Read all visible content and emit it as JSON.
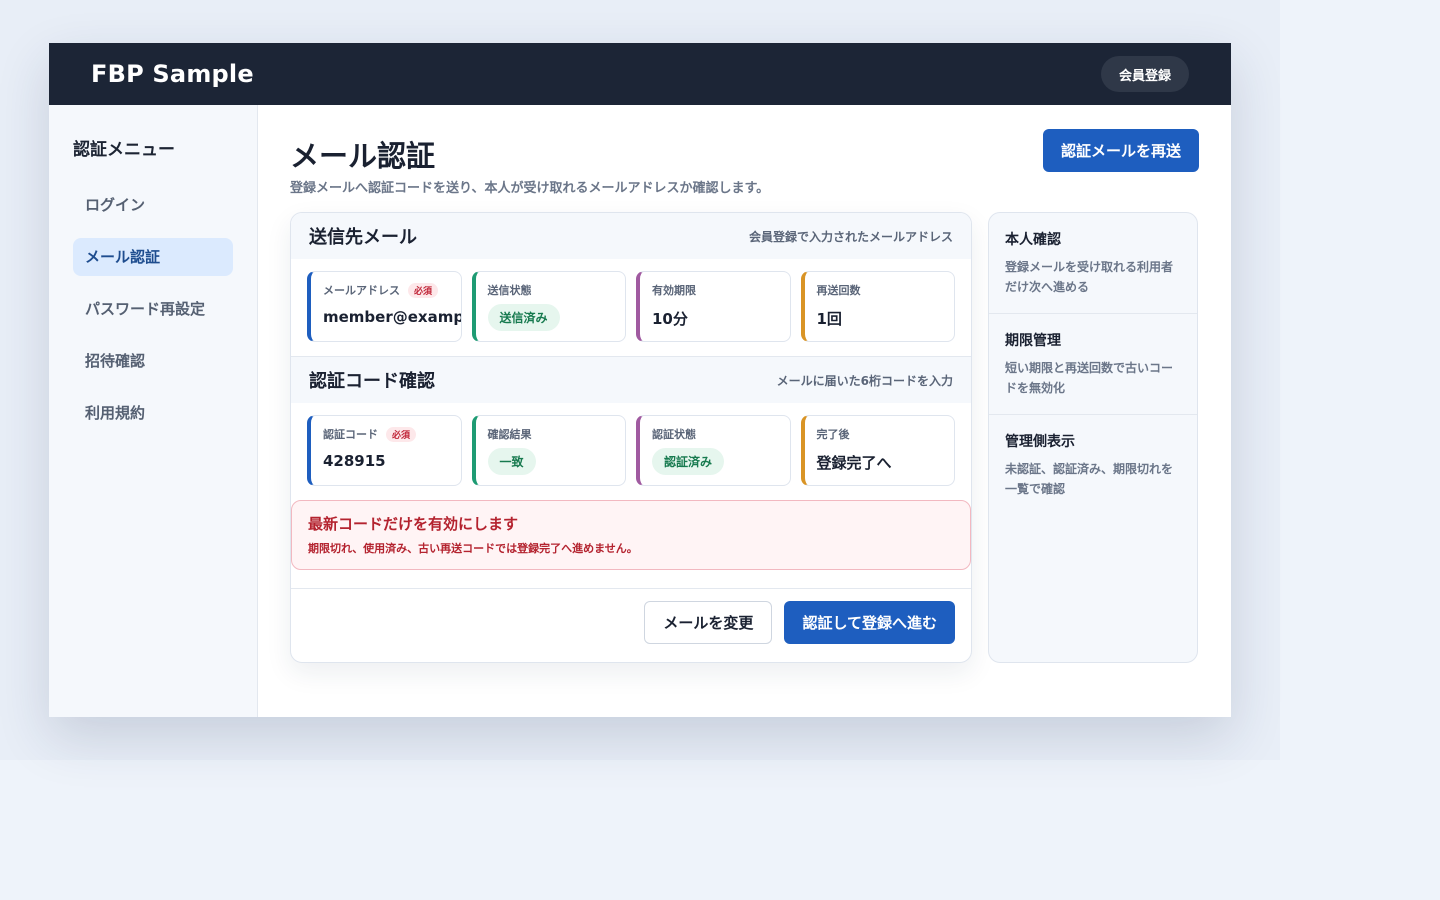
{
  "header": {
    "brand": "FBP Sample",
    "register_button": "会員登録"
  },
  "sidebar": {
    "title": "認証メニュー",
    "items": [
      {
        "label": "ログイン",
        "active": false
      },
      {
        "label": "メール認証",
        "active": true
      },
      {
        "label": "パスワード再設定",
        "active": false
      },
      {
        "label": "招待確認",
        "active": false
      },
      {
        "label": "利用規約",
        "active": false
      }
    ]
  },
  "main": {
    "title": "メール認証",
    "subtitle": "登録メールへ認証コードを送り、本人が受け取れるメールアドレスか確認します。",
    "resend_button": "認証メールを再送"
  },
  "sections": [
    {
      "title": "送信先メール",
      "note": "会員登録で入力されたメールアドレス",
      "fields": [
        {
          "label": "メールアドレス",
          "required": "必須",
          "value": "member@example.com"
        },
        {
          "label": "送信状態",
          "pill": "送信済み"
        },
        {
          "label": "有効期限",
          "value": "10分"
        },
        {
          "label": "再送回数",
          "value": "1回"
        }
      ]
    },
    {
      "title": "認証コード確認",
      "note": "メールに届いた6桁コードを入力",
      "fields": [
        {
          "label": "認証コード",
          "required": "必須",
          "value": "428915"
        },
        {
          "label": "確認結果",
          "pill": "一致"
        },
        {
          "label": "認証状態",
          "pill": "認証済み"
        },
        {
          "label": "完了後",
          "value": "登録完了へ"
        }
      ]
    }
  ],
  "alert": {
    "title": "最新コードだけを有効にします",
    "body": "期限切れ、使用済み、古い再送コードでは登録完了へ進めません。"
  },
  "footer": {
    "change_email_button": "メールを変更",
    "submit_button": "認証して登録へ進む"
  },
  "aside": [
    {
      "title": "本人確認",
      "body": "登録メールを受け取れる利用者だけ次へ進める"
    },
    {
      "title": "期限管理",
      "body": "短い期限と再送回数で古いコードを無効化"
    },
    {
      "title": "管理側表示",
      "body": "未認証、認証済み、期限切れを一覧で確認"
    }
  ],
  "colors": {
    "topbar": "#1c2536",
    "primary": "#1e5ebf",
    "accent_blue": "#1e5ebf",
    "accent_green": "#1e9b73",
    "accent_purple": "#a05aa0",
    "accent_orange": "#d99425",
    "danger": "#b4232f"
  }
}
